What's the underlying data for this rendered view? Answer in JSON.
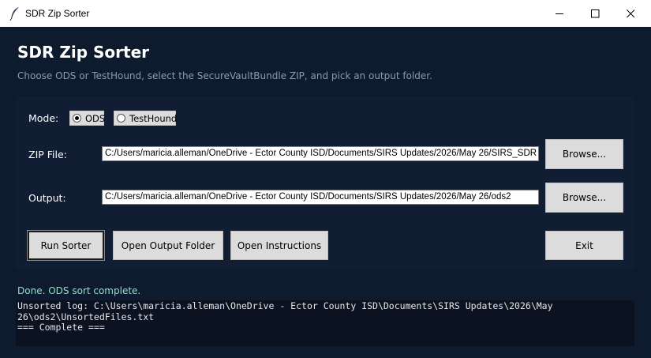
{
  "window": {
    "title": "SDR Zip Sorter"
  },
  "app": {
    "heading": "SDR Zip Sorter",
    "subtitle": "Choose ODS or TestHound, select the SecureVaultBundle ZIP, and pick an output folder."
  },
  "mode": {
    "label": "Mode:",
    "options": [
      {
        "label": "ODS",
        "selected": true
      },
      {
        "label": "TestHound",
        "selected": false
      }
    ]
  },
  "zip": {
    "label": "ZIP File:",
    "value": "C:/Users/maricia.alleman/OneDrive - Ector County ISD/Documents/SIRS Updates/2026/May 26/SIRS_SDR",
    "browse_label": "Browse..."
  },
  "output": {
    "label": "Output:",
    "value": "C:/Users/maricia.alleman/OneDrive - Ector County ISD/Documents/SIRS Updates/2026/May 26/ods2",
    "browse_label": "Browse..."
  },
  "actions": {
    "run_label": "Run Sorter",
    "open_output_label": "Open Output Folder",
    "open_instructions_label": "Open Instructions",
    "exit_label": "Exit"
  },
  "status": {
    "text": "Done. ODS sort complete."
  },
  "log": {
    "text": "Unsorted log: C:\\Users\\maricia.alleman\\OneDrive - Ector County ISD\\Documents\\SIRS Updates\\2026\\May\n26\\ods2\\UnsortedFiles.txt\n=== Complete ==="
  },
  "colors": {
    "background": "#0e1a2e",
    "panel": "#111d33",
    "status_text": "#8fe0c8"
  },
  "icons": {
    "app": "feather-icon",
    "minimize": "minimize-icon",
    "maximize": "maximize-icon",
    "close": "close-icon"
  }
}
